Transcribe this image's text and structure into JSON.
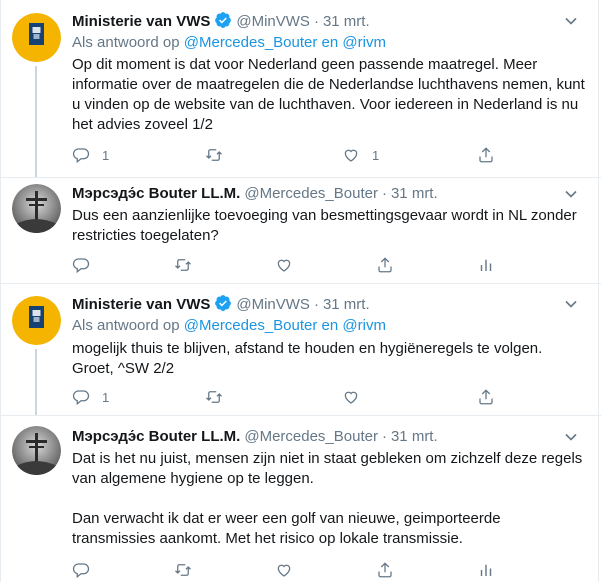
{
  "tweets": [
    {
      "author_name": "Ministerie van VWS",
      "handle": "@MinVWS",
      "dot": "·",
      "date": "31 mrt.",
      "reply_prefix": "Als antwoord op",
      "reply_user1": "@Mercedes_Bouter",
      "reply_and": "en",
      "reply_user2": "@rivm",
      "text": "Op dit moment is dat voor Nederland geen passende maatregel. Meer informatie over de maatregelen die de Nederlandse luchthavens nemen, kunt u vinden op de website van de luchthaven. Voor iedereen in Nederland is nu het advies zoveel 1/2",
      "reply_count": "1",
      "like_count": "1",
      "verified": true
    },
    {
      "author_name": "Мэрсэдэ́с Bouter LL.M.",
      "handle": "@Mercedes_Bouter",
      "dot": "·",
      "date": "31 mrt.",
      "text": "Dus een aanzienlijke toevoeging van besmettingsgevaar wordt in NL zonder restricties toegelaten?"
    },
    {
      "author_name": "Ministerie van VWS",
      "handle": "@MinVWS",
      "dot": "·",
      "date": "31 mrt.",
      "reply_prefix": "Als antwoord op",
      "reply_user1": "@Mercedes_Bouter",
      "reply_and": "en",
      "reply_user2": "@rivm",
      "text": "mogelijk thuis te blijven, afstand te houden en hygiëneregels te volgen. Groet, ^SW 2/2",
      "reply_count": "1",
      "verified": true
    },
    {
      "author_name": "Мэрсэдэ́с Bouter LL.M.",
      "handle": "@Mercedes_Bouter",
      "dot": "·",
      "date": "31 mrt.",
      "text": "Dat is het nu juist, mensen zijn niet in staat gebleken om zichzelf deze regels van algemene hygiene op te leggen.\n\nDan verwacht ik dat er weer een golf van nieuwe, geimporteerde transmissies aankomt. Met het risico op lokale transmissie."
    }
  ],
  "colors": {
    "link": "#1b95e0",
    "muted": "#657786",
    "verified": "#1da1f2",
    "vws_yellow": "#f4b400",
    "vws_blue": "#154273"
  },
  "icons": [
    "reply-icon",
    "retweet-icon",
    "like-icon",
    "share-icon",
    "analytics-icon",
    "chevron-down-icon",
    "verified-badge-icon"
  ]
}
